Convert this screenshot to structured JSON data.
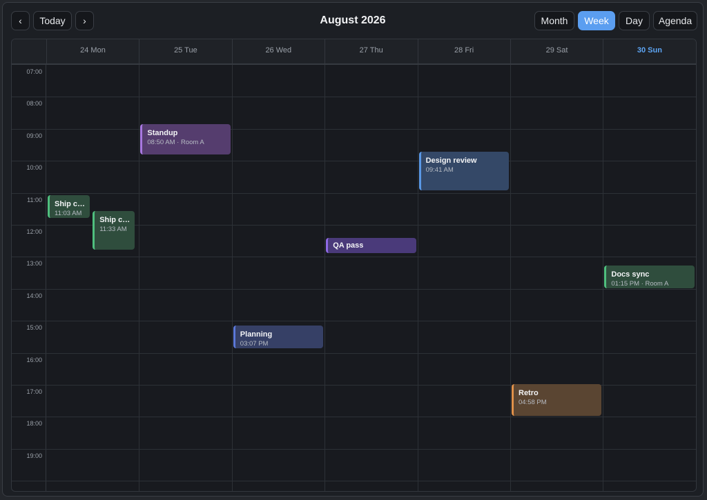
{
  "toolbar": {
    "prev_label": "‹",
    "today_label": "Today",
    "next_label": "›",
    "title": "August 2026",
    "views": [
      {
        "label": "Month",
        "active": false
      },
      {
        "label": "Week",
        "active": true
      },
      {
        "label": "Day",
        "active": false
      },
      {
        "label": "Agenda",
        "active": false
      }
    ]
  },
  "days": [
    {
      "label": "24 Mon",
      "today": false
    },
    {
      "label": "25 Tue",
      "today": false
    },
    {
      "label": "26 Wed",
      "today": false
    },
    {
      "label": "27 Thu",
      "today": false
    },
    {
      "label": "28 Fri",
      "today": false
    },
    {
      "label": "29 Sat",
      "today": false
    },
    {
      "label": "30 Sun",
      "today": true
    }
  ],
  "hours": [
    "07:00",
    "08:00",
    "09:00",
    "10:00",
    "11:00",
    "12:00",
    "13:00",
    "14:00",
    "15:00",
    "16:00",
    "17:00",
    "18:00",
    "19:00"
  ],
  "events": [
    {
      "title": "Standup",
      "sub": "08:50 AM · Room A",
      "day": 1,
      "start": 8.8333,
      "end": 9.8333,
      "bg": "#553d6e",
      "border": "#a878e0"
    },
    {
      "title": "Design review",
      "sub": "09:41 AM",
      "day": 4,
      "start": 9.6833,
      "end": 10.9333,
      "bg": "#344867",
      "border": "#5a98e6"
    },
    {
      "title": "Ship ch...",
      "sub": "11:03 AM",
      "day": 0,
      "start": 11.05,
      "end": 11.8,
      "bg": "#2f4d3d",
      "border": "#4fbf7e",
      "lane": 0,
      "lanes": 2
    },
    {
      "title": "Ship ch...",
      "sub": "11:33 AM",
      "day": 0,
      "start": 11.55,
      "end": 12.8,
      "bg": "#2f4d3d",
      "border": "#4fbf7e",
      "lane": 1,
      "lanes": 2
    },
    {
      "title": "QA pass",
      "sub": "",
      "day": 3,
      "start": 12.3833,
      "end": 12.9,
      "bg": "#4a3a7a",
      "border": "#8f6ae6"
    },
    {
      "title": "Docs sync",
      "sub": "01:15 PM · Room A",
      "day": 6,
      "start": 13.25,
      "end": 14.0,
      "bg": "#2f4d3d",
      "border": "#4fbf7e"
    },
    {
      "title": "Planning",
      "sub": "03:07 PM",
      "day": 2,
      "start": 15.1167,
      "end": 15.8833,
      "bg": "#364066",
      "border": "#5b78d8"
    },
    {
      "title": "Retro",
      "sub": "04:58 PM",
      "day": 5,
      "start": 16.9667,
      "end": 18.0,
      "bg": "#5a4532",
      "border": "#e0914a"
    }
  ]
}
